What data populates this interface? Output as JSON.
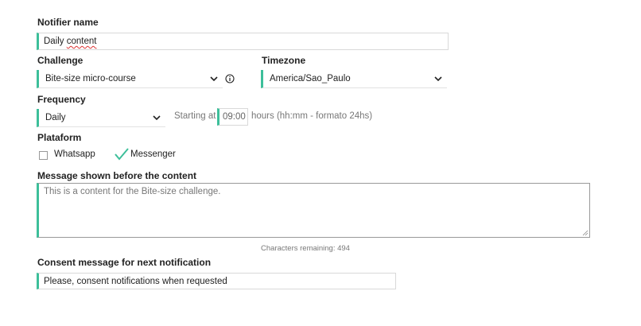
{
  "notifier": {
    "label": "Notifier name",
    "value_word1": "Daily",
    "value_word2": "content"
  },
  "challenge": {
    "label": "Challenge",
    "selected": "Bite-size micro-course"
  },
  "timezone": {
    "label": "Timezone",
    "selected": "America/Sao_Paulo"
  },
  "frequency": {
    "label": "Frequency",
    "selected": "Daily",
    "starting_at": "Starting at",
    "time_value": "09:00",
    "hours_hint": "hours (hh:mm - formato 24hs)"
  },
  "platform": {
    "label": "Plataform",
    "options": [
      {
        "label": "Whatsapp",
        "checked": false
      },
      {
        "label": "Messenger",
        "checked": true
      }
    ]
  },
  "message": {
    "label": "Message shown before the content",
    "value": "This is a content for the Bite-size challenge.",
    "chars_remaining": "Characters remaining: 494"
  },
  "consent": {
    "label": "Consent message for next notification",
    "value": "Please, consent notifications when requested"
  },
  "colors": {
    "accent": "#3dbf9a",
    "border": "#d9d9d9",
    "muted_text": "#777777"
  },
  "icons": {
    "chevron": "chevron-down-icon",
    "info": "info-icon",
    "check": "checkmark-icon",
    "resize": "resize-grip-icon"
  }
}
